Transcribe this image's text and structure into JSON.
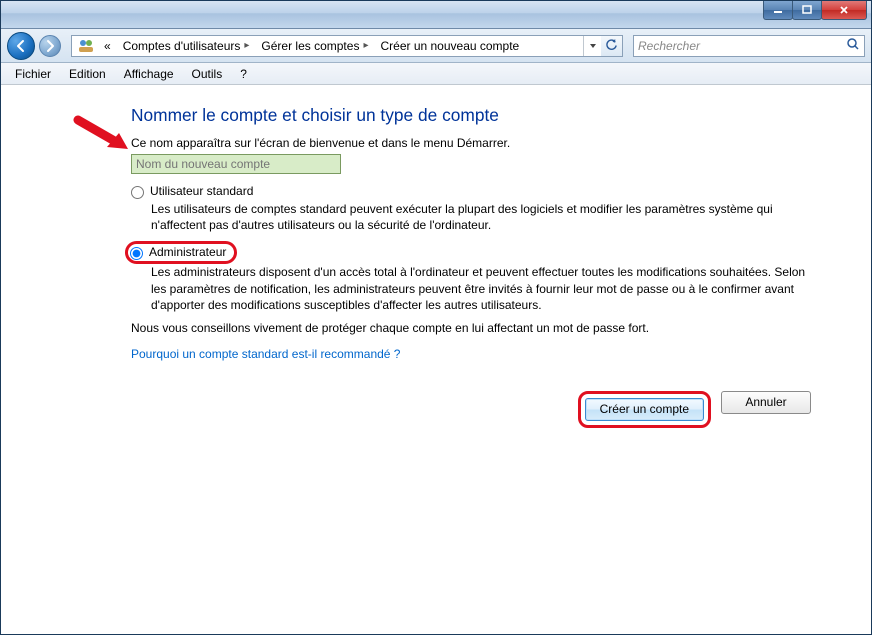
{
  "window_controls": {
    "minimize": "minimize",
    "maximize": "maximize",
    "close": "close"
  },
  "breadcrumb": {
    "prefix": "«",
    "items": [
      "Comptes d'utilisateurs",
      "Gérer les comptes",
      "Créer un nouveau compte"
    ]
  },
  "search": {
    "placeholder": "Rechercher"
  },
  "menubar": {
    "items": [
      "Fichier",
      "Edition",
      "Affichage",
      "Outils",
      "?"
    ]
  },
  "page": {
    "title": "Nommer le compte et choisir un type de compte",
    "subtitle": "Ce nom apparaîtra sur l'écran de bienvenue et dans le menu Démarrer.",
    "input_placeholder": "Nom du nouveau compte",
    "options": {
      "standard": {
        "label": "Utilisateur standard",
        "desc": "Les utilisateurs de comptes standard peuvent exécuter la plupart des logiciels et modifier les paramètres système qui n'affectent pas d'autres utilisateurs ou la sécurité de l'ordinateur.",
        "selected": false
      },
      "admin": {
        "label": "Administrateur",
        "desc": "Les administrateurs disposent d'un accès total à l'ordinateur et peuvent effectuer toutes les modifications souhaitées. Selon les paramètres de notification, les administrateurs peuvent être invités à fournir leur mot de passe ou à le confirmer avant d'apporter des modifications susceptibles d'affecter les autres utilisateurs.",
        "selected": true
      }
    },
    "advice": "Nous vous conseillons vivement de protéger chaque compte en lui affectant un mot de passe fort.",
    "help_link": "Pourquoi un compte standard est-il recommandé ?",
    "create_button": "Créer un compte",
    "cancel_button": "Annuler"
  }
}
